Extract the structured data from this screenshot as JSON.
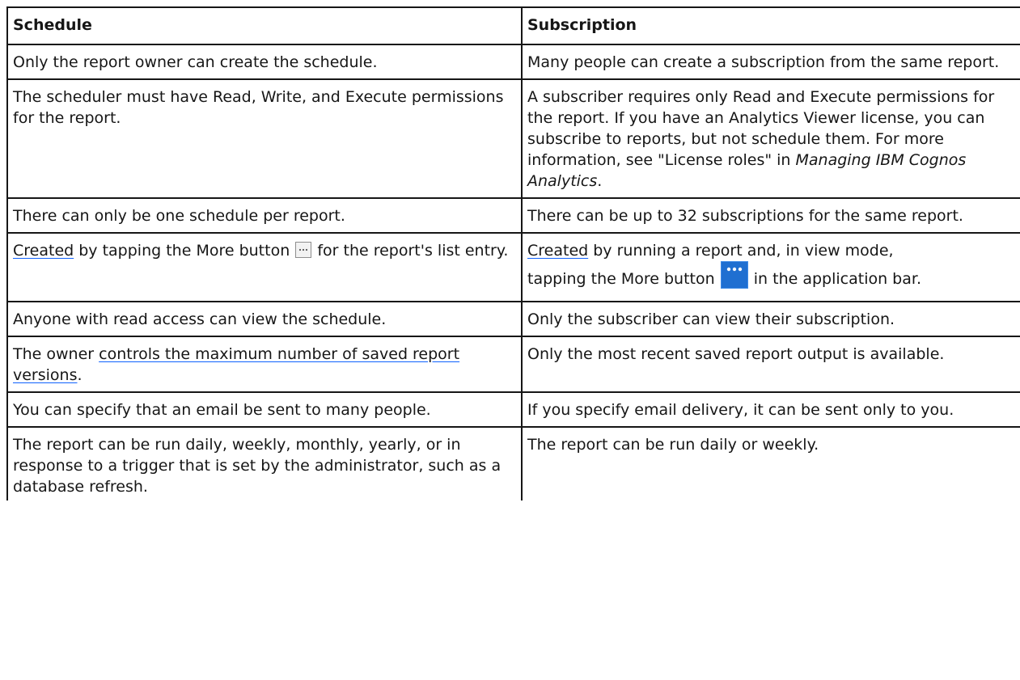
{
  "table": {
    "headers": {
      "schedule": "Schedule",
      "subscription": "Subscription"
    },
    "rows": [
      {
        "schedule": "Only the report owner can create the schedule.",
        "subscription": "Many people can create a subscription from the same report."
      },
      {
        "schedule": "The scheduler must have Read, Write, and Execute permissions for the report.",
        "subscription": {
          "text": "A subscriber requires only Read and Execute permissions for the report. If you have an Analytics Viewer license, you can subscribe to reports, but not schedule them. For more information, see \"License roles\" in ",
          "citation": "Managing IBM Cognos Analytics",
          "end": "."
        }
      },
      {
        "schedule": "There can only be one schedule per report.",
        "subscription": "There can be up to 32 subscriptions for the same report."
      },
      {
        "schedule": {
          "link": "Created",
          "before_icon": " by tapping the More button ",
          "after_icon": " for the report's list entry."
        },
        "subscription": {
          "link": "Created",
          "line1_rest": " by running a report and, in view mode,",
          "before_icon": "tapping the More button ",
          "after_icon": " in the application bar."
        }
      },
      {
        "schedule": "Anyone with read access can view the schedule.",
        "subscription": "Only the subscriber can view their subscription."
      },
      {
        "schedule": {
          "before_link": "The owner ",
          "link": "controls the maximum number of saved report versions",
          "end": "."
        },
        "subscription": "Only the most recent saved report output is available."
      },
      {
        "schedule": "You can specify that an email be sent to many people.",
        "subscription": "If you specify email delivery, it can be sent only to you."
      },
      {
        "schedule": "The report can be run daily, weekly, monthly, yearly, or in response to a trigger that is set by the administrator, such as a database refresh.",
        "subscription": "The report can be run daily or weekly."
      }
    ]
  },
  "icons": {
    "more_small": "more-ellipsis-icon",
    "more_large": "more-ellipsis-icon"
  },
  "colors": {
    "text": "#161616",
    "link_underline": "#0f62fe",
    "more_button_blue": "#1f6fd1"
  }
}
